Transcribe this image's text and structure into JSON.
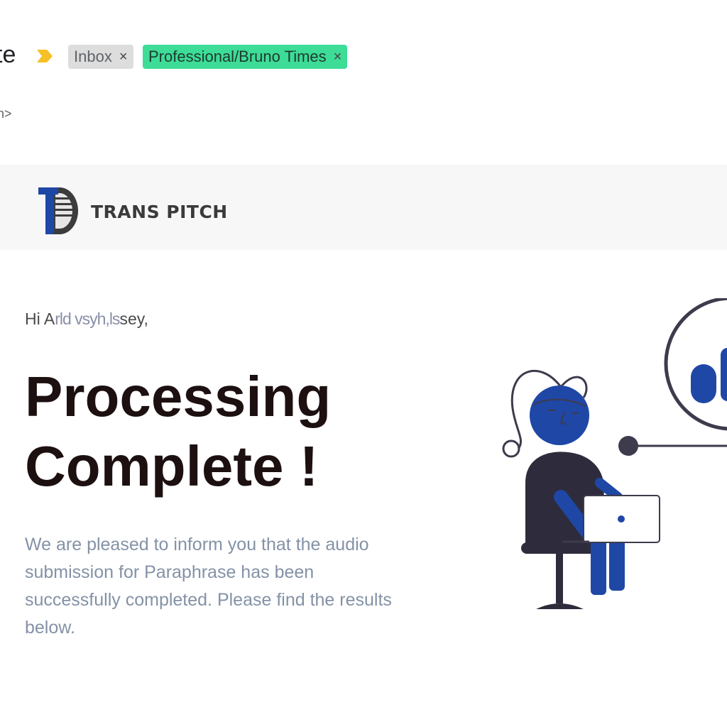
{
  "email": {
    "subject_fragment": "te",
    "labels": [
      {
        "name": "Inbox",
        "remove": "×"
      },
      {
        "name": "Professional/Bruno Times",
        "remove": "×"
      }
    ],
    "sender_fragment": "n>"
  },
  "brand": {
    "name": "TRANS PITCH"
  },
  "message": {
    "greeting_prefix": "Hi A",
    "greeting_name_obscured": "rld vsyh,ls",
    "greeting_suffix": "sey,",
    "headline_line1": "Processing",
    "headline_line2": "Complete !",
    "body": "We are pleased to inform you that the audio submission for Paraphrase has been successfully completed. Please find the results below."
  },
  "colors": {
    "label_inbox_bg": "#dddddd",
    "label_pro_bg": "#3ddc97",
    "importance_marker": "#f6c026",
    "brand_blue": "#1f47a6",
    "headline": "#1d1010",
    "body_text": "#8492a6"
  },
  "icons": {
    "importance": "importance-marker-icon",
    "logo": "trans-pitch-logo",
    "illustration": "person-with-laptop-and-mic-illustration"
  }
}
